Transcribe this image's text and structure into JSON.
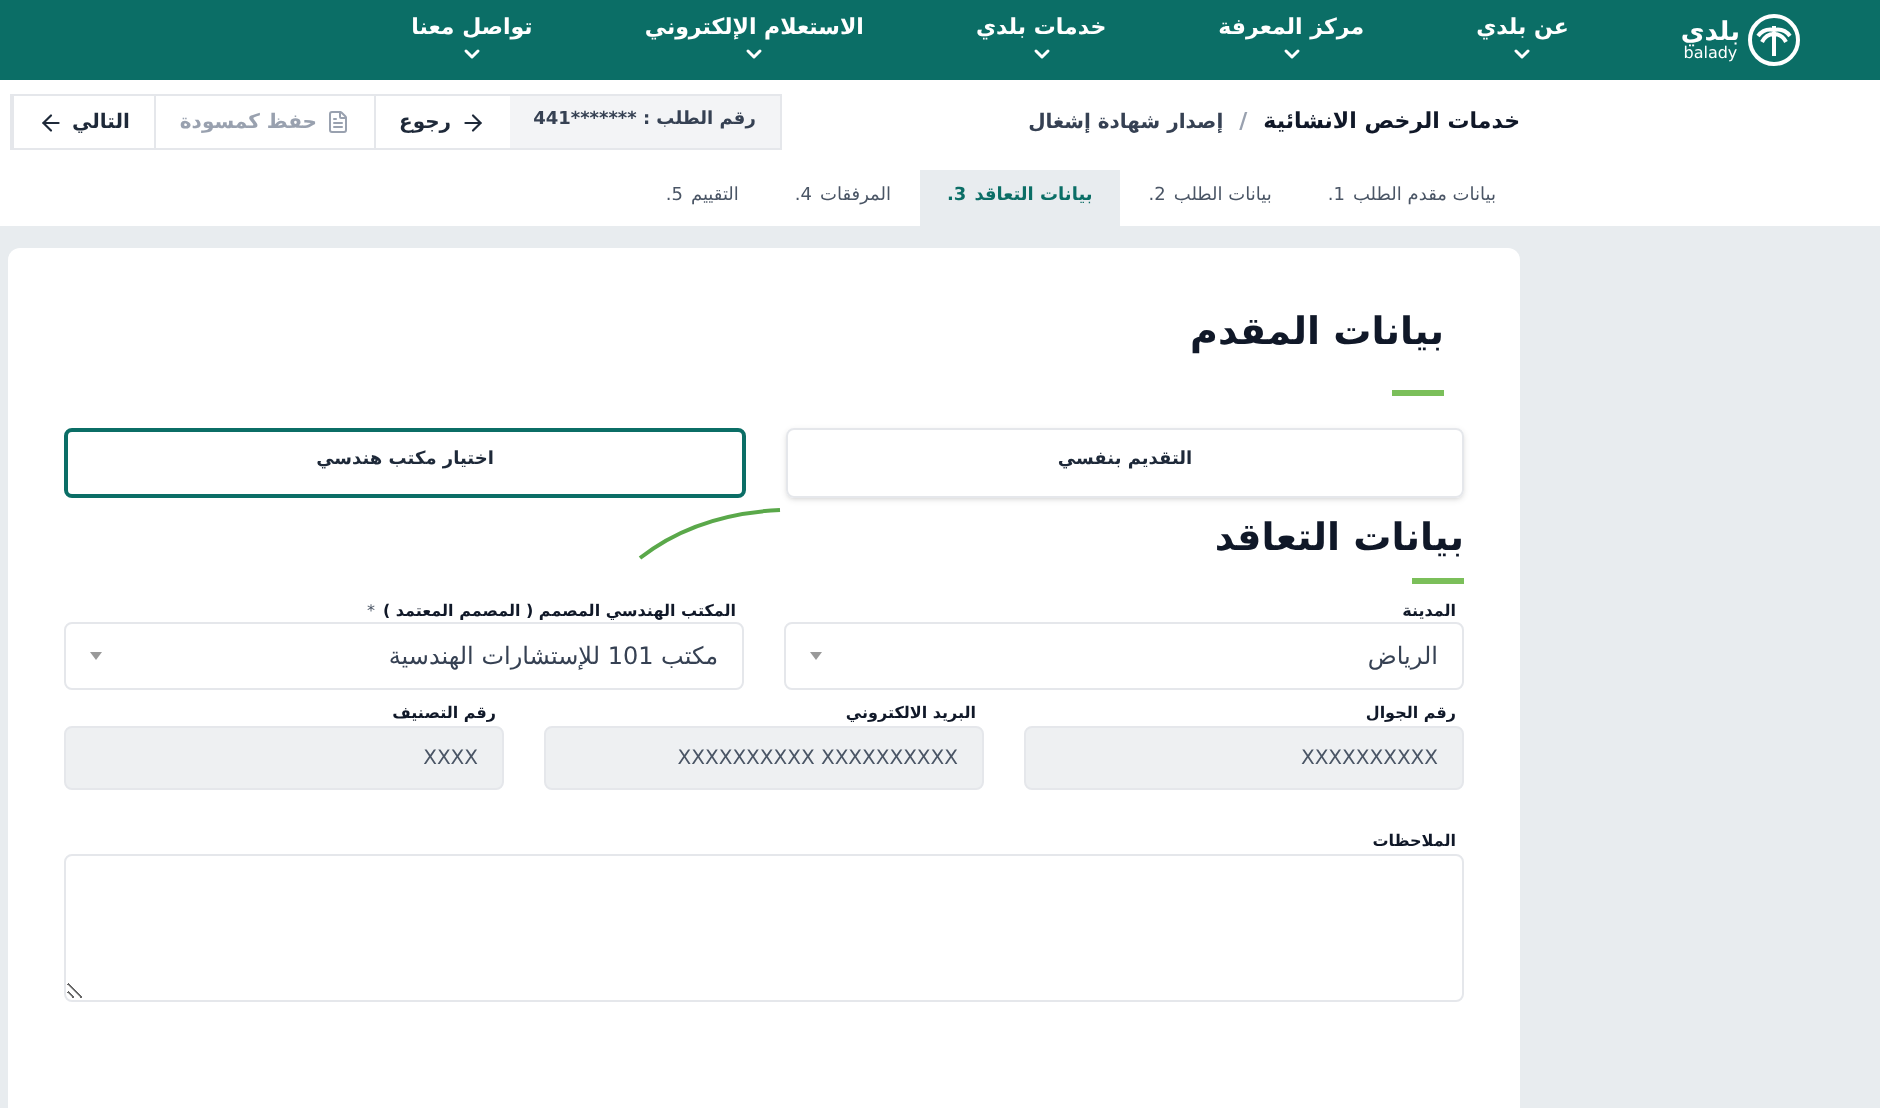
{
  "header": {
    "logo": {
      "arabic": "بلدي",
      "latin": "balady"
    },
    "nav": [
      {
        "label": "عن بلدي"
      },
      {
        "label": "مركز المعرفة"
      },
      {
        "label": "خدمات بلدي"
      },
      {
        "label": "الاستعلام الإلكتروني"
      },
      {
        "label": "تواصل معنا"
      }
    ]
  },
  "toolbar": {
    "breadcrumb": [
      "خدمات الرخص الانشائية",
      "إصدار شهادة إشغال"
    ],
    "breadcrumb_separator": "/",
    "request_number": "رقم الطلب : *******441",
    "buttons": [
      {
        "kind": "back",
        "label": "رجوع"
      },
      {
        "kind": "draft",
        "label": "حفظ كمسودة"
      },
      {
        "kind": "next",
        "label": "التالي"
      }
    ]
  },
  "steps": [
    {
      "number": "1.",
      "label": "بيانات مقدم الطلب",
      "selected": false
    },
    {
      "number": "2.",
      "label": "بيانات الطلب",
      "selected": false
    },
    {
      "number": "3.",
      "label": "بيانات التعاقد",
      "selected": true
    },
    {
      "number": "4.",
      "label": "المرفقات",
      "selected": false
    },
    {
      "number": "5.",
      "label": "التقييم",
      "selected": false
    }
  ],
  "applicant": {
    "title": "بيانات المقدم",
    "options": [
      {
        "label": "التقديم بنفسي",
        "selected": false
      },
      {
        "label": "اختيار مكتب هندسي",
        "selected": true
      }
    ]
  },
  "contract": {
    "title": "بيانات التعاقد",
    "selects": [
      {
        "label": "المدينة",
        "value": "الرياض"
      },
      {
        "label": "المكتب الهندسي المصمم ( المصمم المعتمد )",
        "required_mark": "*",
        "value": "مكتب 101 للإستشارات الهندسية"
      }
    ],
    "fields": [
      {
        "label": "رقم الجوال",
        "value": "XXXXXXXXXX"
      },
      {
        "label": "البريد الالكتروني",
        "value": "XXXXXXXXXX XXXXXXXXXX"
      },
      {
        "label": "رقم التصنيف",
        "value": "XXXX"
      }
    ],
    "notes": {
      "label": "الملاحظات"
    }
  }
}
